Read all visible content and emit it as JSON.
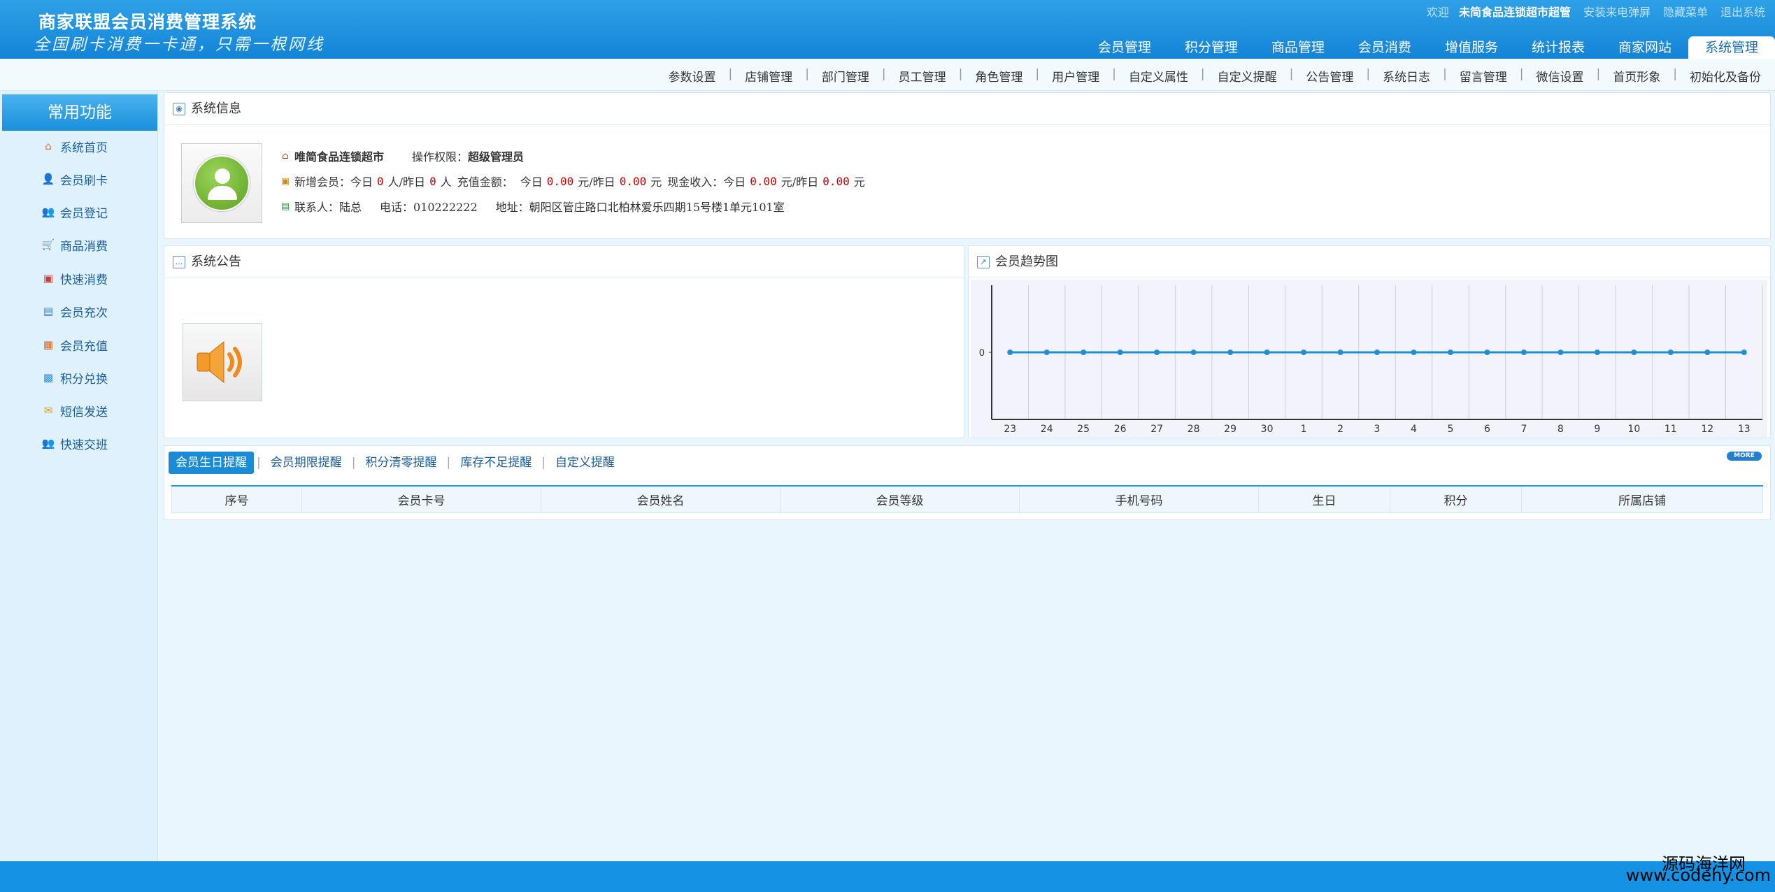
{
  "header": {
    "title": "商家联盟会员消费管理系统",
    "slogan": "全国刷卡消费一卡通，只需一根网线",
    "welcome": "欢迎",
    "user": "未简食品连锁超市超管",
    "links": [
      "安装来电弹屏",
      "隐藏菜单",
      "退出系统"
    ]
  },
  "mainnav": [
    "会员管理",
    "积分管理",
    "商品管理",
    "会员消费",
    "增值服务",
    "统计报表",
    "商家网站",
    "系统管理"
  ],
  "subnav": [
    "参数设置",
    "店铺管理",
    "部门管理",
    "员工管理",
    "角色管理",
    "用户管理",
    "自定义属性",
    "自定义提醒",
    "公告管理",
    "系统日志",
    "留言管理",
    "微信设置",
    "首页形象",
    "初始化及备份"
  ],
  "sidebar": {
    "title": "常用功能",
    "items": [
      {
        "label": "系统首页",
        "icon": "home-icon"
      },
      {
        "label": "会员刷卡",
        "icon": "card-user-icon"
      },
      {
        "label": "会员登记",
        "icon": "user-add-icon"
      },
      {
        "label": "商品消费",
        "icon": "cart-icon"
      },
      {
        "label": "快速消费",
        "icon": "fast-icon"
      },
      {
        "label": "会员充次",
        "icon": "recharge-count-icon"
      },
      {
        "label": "会员充值",
        "icon": "recharge-icon"
      },
      {
        "label": "积分兑换",
        "icon": "gift-icon"
      },
      {
        "label": "短信发送",
        "icon": "mail-icon"
      },
      {
        "label": "快速交班",
        "icon": "shift-icon"
      }
    ]
  },
  "sysinfo": {
    "title": "系统信息",
    "store": "唯简食品连锁超市",
    "perm_label": "操作权限：",
    "perm": "超级管理员",
    "new_member_label": "新增会员：今日",
    "new_today": "0",
    "new_yesterday_label": "人/昨日",
    "new_yesterday": "0",
    "person_unit": "人",
    "recharge_label": "充值金额：",
    "today_label": "今日",
    "recharge_today": "0.00",
    "yuan_yesterday_label": "元/昨日",
    "recharge_yesterday": "0.00",
    "yuan": "元",
    "cash_label": "现金收入：",
    "cash_today": "0.00",
    "cash_yesterday": "0.00",
    "contact": "联系人：陆总",
    "phone": "电话：010222222",
    "address": "地址：朝阳区管庄路口北柏林爱乐四期15号楼1单元101室"
  },
  "notice": {
    "title": "系统公告"
  },
  "trend": {
    "title": "会员趋势图"
  },
  "chart_data": {
    "type": "line",
    "categories": [
      "23",
      "24",
      "25",
      "26",
      "27",
      "28",
      "29",
      "30",
      "1",
      "2",
      "3",
      "4",
      "5",
      "6",
      "7",
      "8",
      "9",
      "10",
      "11",
      "12",
      "13"
    ],
    "series": [
      {
        "values": [
          0,
          0,
          0,
          0,
          0,
          0,
          0,
          0,
          0,
          0,
          0,
          0,
          0,
          0,
          0,
          0,
          0,
          0,
          0,
          0,
          0
        ]
      }
    ],
    "yticks": [
      "0"
    ],
    "color": "#1f8fcf"
  },
  "reminders": {
    "tabs": [
      "会员生日提醒",
      "会员期限提醒",
      "积分清零提醒",
      "库存不足提醒",
      "自定义提醒"
    ],
    "more": "MORE",
    "columns": [
      "序号",
      "会员卡号",
      "会员姓名",
      "会员等级",
      "手机号码",
      "生日",
      "积分",
      "所属店铺"
    ]
  },
  "watermark": {
    "line1": "源码海洋网",
    "line2": "www.codehy.com"
  }
}
